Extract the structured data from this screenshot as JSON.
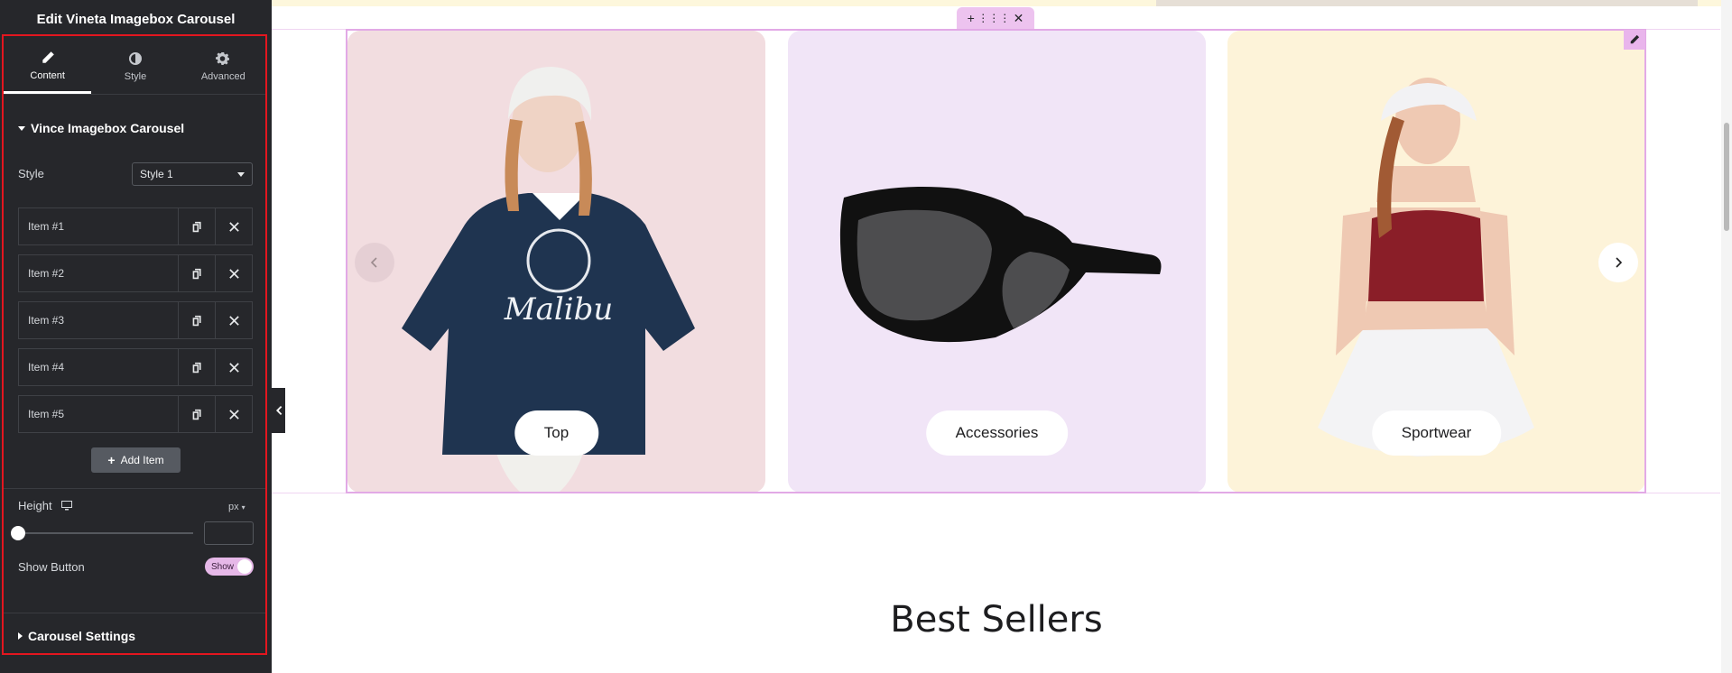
{
  "panel": {
    "title": "Edit Vineta Imagebox Carousel",
    "tabs": [
      {
        "label": "Content",
        "icon": "pencil-icon",
        "active": true
      },
      {
        "label": "Style",
        "icon": "half-circle-icon",
        "active": false
      },
      {
        "label": "Advanced",
        "icon": "gear-icon",
        "active": false
      }
    ],
    "section_title": "Vince Imagebox Carousel",
    "style_label": "Style",
    "style_value": "Style 1",
    "items": [
      "Item #1",
      "Item #2",
      "Item #3",
      "Item #4",
      "Item #5"
    ],
    "add_item_label": "Add Item",
    "height_label": "Height",
    "height_unit": "px",
    "height_value": "",
    "show_button_label": "Show Button",
    "show_button_toggle": "Show",
    "carousel_settings_label": "Carousel Settings"
  },
  "canvas": {
    "cards": [
      {
        "label": "Top",
        "bg": "#f2dde0"
      },
      {
        "label": "Accessories",
        "bg": "#f1e5f7"
      },
      {
        "label": "Sportwear",
        "bg": "#fdf3d9"
      }
    ],
    "heading": "Best Sellers"
  },
  "colors": {
    "panel_bg": "#26272b",
    "highlight": "#e3161f",
    "outline": "#e2a9e6"
  }
}
